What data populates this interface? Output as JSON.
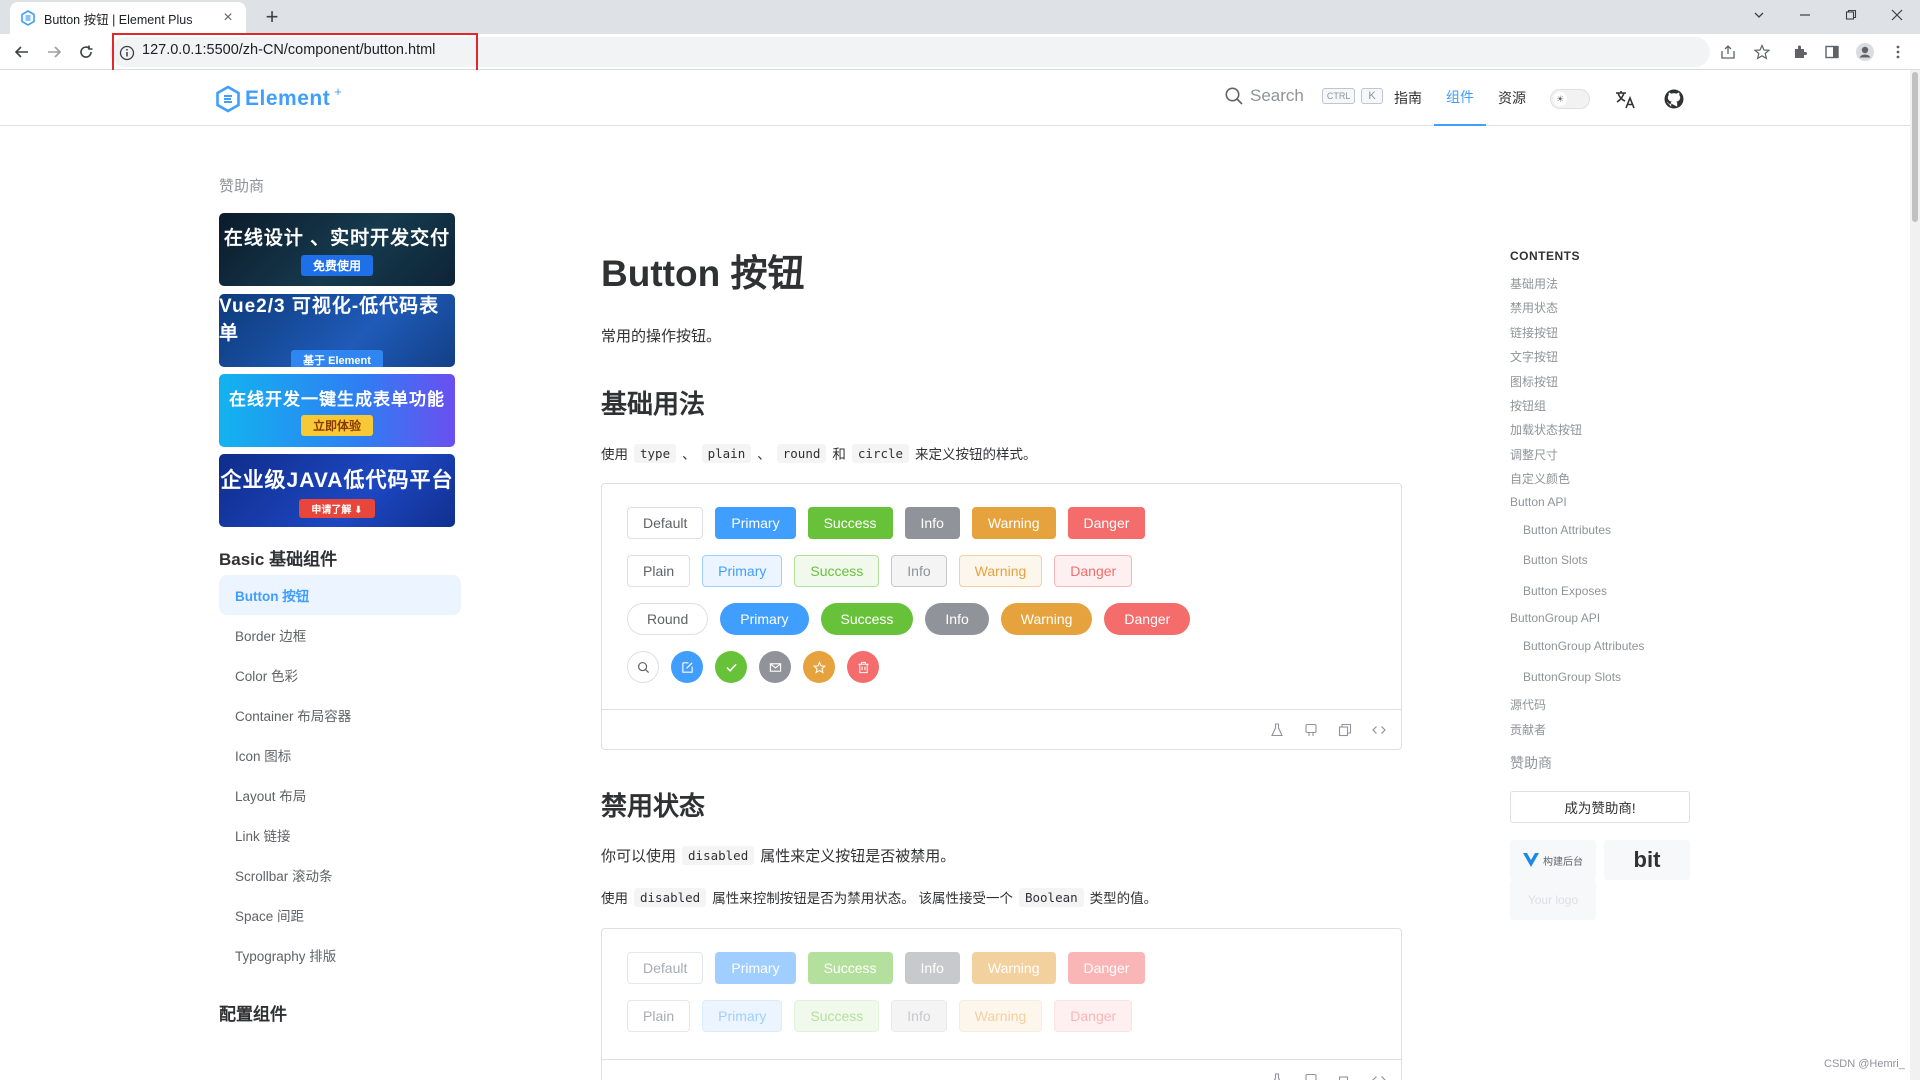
{
  "browser": {
    "tab_title": "Button 按钮 | Element Plus",
    "url": "127.0.0.1:5500/zh-CN/component/button.html"
  },
  "header": {
    "logo_text": "Element",
    "logo_sup": "+",
    "search_label": "Search",
    "kbd_ctrl": "CTRL",
    "kbd_k": "K",
    "nav": [
      "指南",
      "组件",
      "资源"
    ],
    "active_nav": "组件"
  },
  "sidebar": {
    "sponsor_label": "赞助商",
    "banners": [
      {
        "title": "在线设计 、实时开发交付",
        "sub": "免费使用"
      },
      {
        "title": "Vue2/3 可视化-低代码表单",
        "sub": "基于 Element"
      },
      {
        "title": "在线开发一键生成表单功能",
        "sub": "立即体验"
      },
      {
        "title": "企业级JAVA低代码平台",
        "sub": "申请了解 ⬇"
      }
    ],
    "group1": "Basic 基础组件",
    "items": [
      "Button 按钮",
      "Border 边框",
      "Color 色彩",
      "Container 布局容器",
      "Icon 图标",
      "Layout 布局",
      "Link 链接",
      "Scrollbar 滚动条",
      "Space 间距",
      "Typography 排版"
    ],
    "group2": "配置组件"
  },
  "main": {
    "title": "Button 按钮",
    "lead": "常用的操作按钮。",
    "section1": {
      "heading": "基础用法",
      "desc": {
        "p1": "使用",
        "c1": "type",
        "s1": "、",
        "c2": "plain",
        "s2": "、",
        "c3": "round",
        "and": "和",
        "c4": "circle",
        "p2": "来定义按钮的样式。"
      },
      "row1": [
        "Default",
        "Primary",
        "Success",
        "Info",
        "Warning",
        "Danger"
      ],
      "row2": [
        "Plain",
        "Primary",
        "Success",
        "Info",
        "Warning",
        "Danger"
      ],
      "row3": [
        "Round",
        "Primary",
        "Success",
        "Info",
        "Warning",
        "Danger"
      ],
      "row4_icons": [
        "search-icon",
        "edit-icon",
        "check-icon",
        "message-icon",
        "star-icon",
        "delete-icon"
      ]
    },
    "section2": {
      "heading": "禁用状态",
      "desc1": {
        "p1": "你可以使用",
        "c1": "disabled",
        "p2": "属性来定义按钮是否被禁用。"
      },
      "desc2": {
        "p1": "使用",
        "c1": "disabled",
        "p2": "属性来控制按钮是否为禁用状态。 该属性接受一个",
        "c2": "Boolean",
        "p3": "类型的值。"
      },
      "row1": [
        "Default",
        "Primary",
        "Success",
        "Info",
        "Warning",
        "Danger"
      ],
      "row2": [
        "Plain",
        "Primary",
        "Success",
        "Info",
        "Warning",
        "Danger"
      ]
    }
  },
  "toc": {
    "title": "CONTENTS",
    "items": [
      "基础用法",
      "禁用状态",
      "链接按钮",
      "文字按钮",
      "图标按钮",
      "按钮组",
      "加载状态按钮",
      "调整尺寸",
      "自定义颜色",
      "Button API",
      "Button Attributes",
      "Button Slots",
      "Button Exposes",
      "ButtonGroup API",
      "ButtonGroup Attributes",
      "ButtonGroup Slots",
      "源代码",
      "贡献者"
    ],
    "sponsor_label": "赞助商",
    "become_sponsor": "成为赞助商!",
    "sponsor1": "构建后台",
    "sponsor2": "bit",
    "sponsor3": "Your logo"
  },
  "watermark": "CSDN @Hemri_",
  "colors": {
    "primary": "#409eff",
    "success": "#67c23a",
    "info": "#909399",
    "warning": "#e6a23c",
    "danger": "#f56c6c"
  }
}
